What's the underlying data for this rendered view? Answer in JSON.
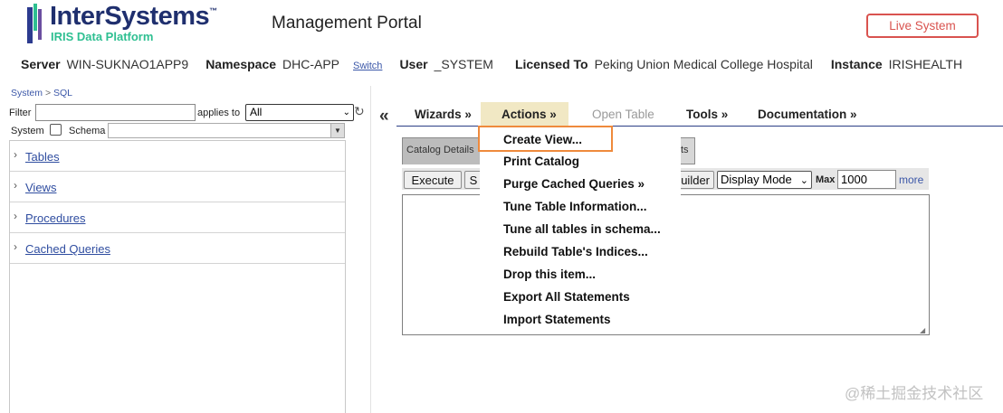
{
  "header": {
    "logo_name": "InterSystems",
    "logo_tm": "™",
    "logo_sub": "IRIS Data Platform",
    "portal_title": "Management Portal",
    "live_system_label": "Live System"
  },
  "infobar": {
    "server_label": "Server",
    "server_value": "WIN-SUKNAO1APP9",
    "namespace_label": "Namespace",
    "namespace_value": "DHC-APP",
    "switch_label": "Switch",
    "user_label": "User",
    "user_value": "_SYSTEM",
    "licensed_label": "Licensed To",
    "licensed_value": "Peking Union Medical College Hospital",
    "instance_label": "Instance",
    "instance_value": "IRISHEALTH"
  },
  "breadcrumb": {
    "root": "System",
    "separator": ">",
    "current": "SQL"
  },
  "filter": {
    "filter_label": "Filter",
    "filter_value": "",
    "applies_to_label": "applies to",
    "applies_to_value": "All",
    "system_label": "System",
    "schema_label": "Schema",
    "schema_value": ""
  },
  "tree": {
    "items": [
      {
        "label": "Tables"
      },
      {
        "label": "Views"
      },
      {
        "label": "Procedures"
      },
      {
        "label": "Cached Queries"
      }
    ]
  },
  "menu": {
    "collapse_glyph": "«",
    "wizards": "Wizards »",
    "actions": "Actions »",
    "open_table": "Open Table",
    "tools": "Tools »",
    "documentation": "Documentation »"
  },
  "tabs": {
    "catalog_details": "Catalog Details",
    "stub": "ts"
  },
  "toolbar": {
    "execute": "Execute",
    "s_button": "S",
    "builder": "uilder",
    "display_mode": "Display Mode",
    "max_label": "Max",
    "max_value": "1000",
    "more": "more"
  },
  "dropdown": {
    "items": [
      "Create View...",
      "Print Catalog",
      "Purge Cached Queries »",
      "Tune Table Information...",
      "Tune all tables in schema...",
      "Rebuild Table's Indices...",
      "Drop this item...",
      "Export All Statements",
      "Import Statements"
    ],
    "highlighted_index": 0
  },
  "colors": {
    "brand_navy": "#1f2f6e",
    "brand_green": "#2ebf91",
    "live_red": "#d9534f",
    "link_blue": "#2f4da0",
    "highlight_orange": "#ef8a3c",
    "actions_bg": "#f1e8c4"
  },
  "watermark": "@稀土掘金技术社区"
}
